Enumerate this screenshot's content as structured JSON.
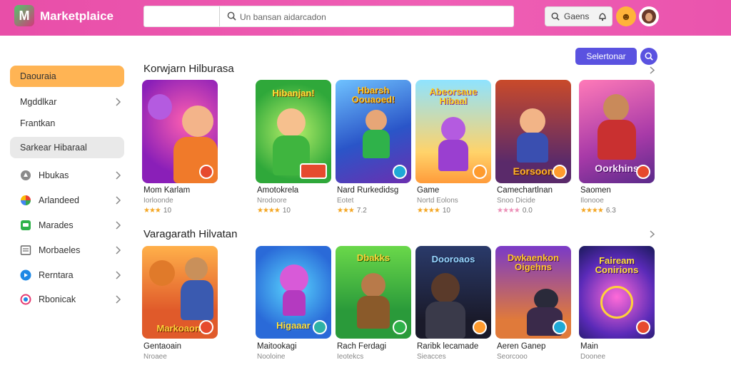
{
  "app": {
    "brand": "Marketplaice",
    "logo_letter": "M"
  },
  "search": {
    "placeholder": "Un bansan aidarcadon",
    "value": ""
  },
  "header": {
    "games_label": "Gaens"
  },
  "colors": {
    "topbar": "#ea54ad",
    "accent": "#5a52e0",
    "active_item": "#ffb454",
    "star": "#f4a623"
  },
  "sidebar": {
    "items": [
      {
        "label": "Daouraia",
        "state": "active",
        "icon": ""
      },
      {
        "label": "Mgddlkar",
        "state": "normal",
        "icon": ""
      },
      {
        "label": "Frantkan",
        "state": "normal",
        "icon": ""
      },
      {
        "label": "Sarkear Hibaraal",
        "state": "hover",
        "icon": ""
      },
      {
        "label": "Hbukas",
        "state": "normal",
        "icon": "circle-icon"
      },
      {
        "label": "Arlandeed",
        "state": "normal",
        "icon": "pinwheel-icon"
      },
      {
        "label": "Marades",
        "state": "normal",
        "icon": "chat-icon"
      },
      {
        "label": "Morbaeles",
        "state": "normal",
        "icon": "document-icon"
      },
      {
        "label": "Rerntara",
        "state": "normal",
        "icon": "play-icon"
      },
      {
        "label": "Rbonicak",
        "state": "normal",
        "icon": "compass-icon"
      }
    ]
  },
  "main": {
    "top_button": "Selertonar",
    "sections": [
      {
        "title": "Korwjarn Hilburasa",
        "cards": [
          {
            "name": "Mom Karlam",
            "sub": "Iorloonde",
            "stars": "★★★",
            "rating": "10",
            "banner": "",
            "badge_color": "#e64a2e",
            "star_style": "gold"
          },
          {
            "name": "Amotokrela",
            "sub": "Nrodoore",
            "stars": "★★★★",
            "rating": "10",
            "banner": "Hibanjan!",
            "badge_color": "#e64a2e",
            "star_style": "gold"
          },
          {
            "name": "Nard Rurkedidsg",
            "sub": "Eotet",
            "stars": "★★★",
            "rating": "7.2",
            "banner": "Hbarsh Oouaoed!",
            "badge_color": "#1fa9d6",
            "star_style": "gold"
          },
          {
            "name": "Game",
            "sub": "Nortd Eolons",
            "stars": "★★★★",
            "rating": "10",
            "banner": "Abeorsaue Hibaal",
            "badge_color": "#ff9b2e",
            "star_style": "gold"
          },
          {
            "name": "Camechartlnan",
            "sub": "Snoo Dicide",
            "stars": "★★★★",
            "rating": "0.0",
            "banner": "Eorsoon",
            "badge_color": "#ff9b2e",
            "star_style": "pink"
          },
          {
            "name": "Saomen",
            "sub": "Ilonooe",
            "stars": "★★★★",
            "rating": "6.3",
            "banner": "Oorkhins",
            "badge_color": "#e64a2e",
            "star_style": "gold"
          }
        ]
      },
      {
        "title": "Varagarath Hilvatan",
        "cards": [
          {
            "name": "Gentaoain",
            "sub": "Nroaee",
            "banner": "Markoaoni",
            "badge_color": "#e64a2e"
          },
          {
            "name": "Maitookagi",
            "sub": "Nooloine",
            "banner": "Higaaar",
            "badge_color": "#2fb2a6"
          },
          {
            "name": "Rach Ferdagi",
            "sub": "Ieotekcs",
            "banner": "Dbakks",
            "badge_color": "#2fb24a"
          },
          {
            "name": "Raribk lecamade",
            "sub": "Sieacces",
            "banner": "Dooroaos",
            "badge_color": "#ff9b2e"
          },
          {
            "name": "Aeren Ganep",
            "sub": "Seorcooo",
            "banner": "Dwkaenkon Oigehns",
            "badge_color": "#1fa9d6"
          },
          {
            "name": "Main",
            "sub": "Doonee",
            "banner": "Faiream Conirions",
            "badge_color": "#e64a2e"
          }
        ]
      }
    ]
  }
}
